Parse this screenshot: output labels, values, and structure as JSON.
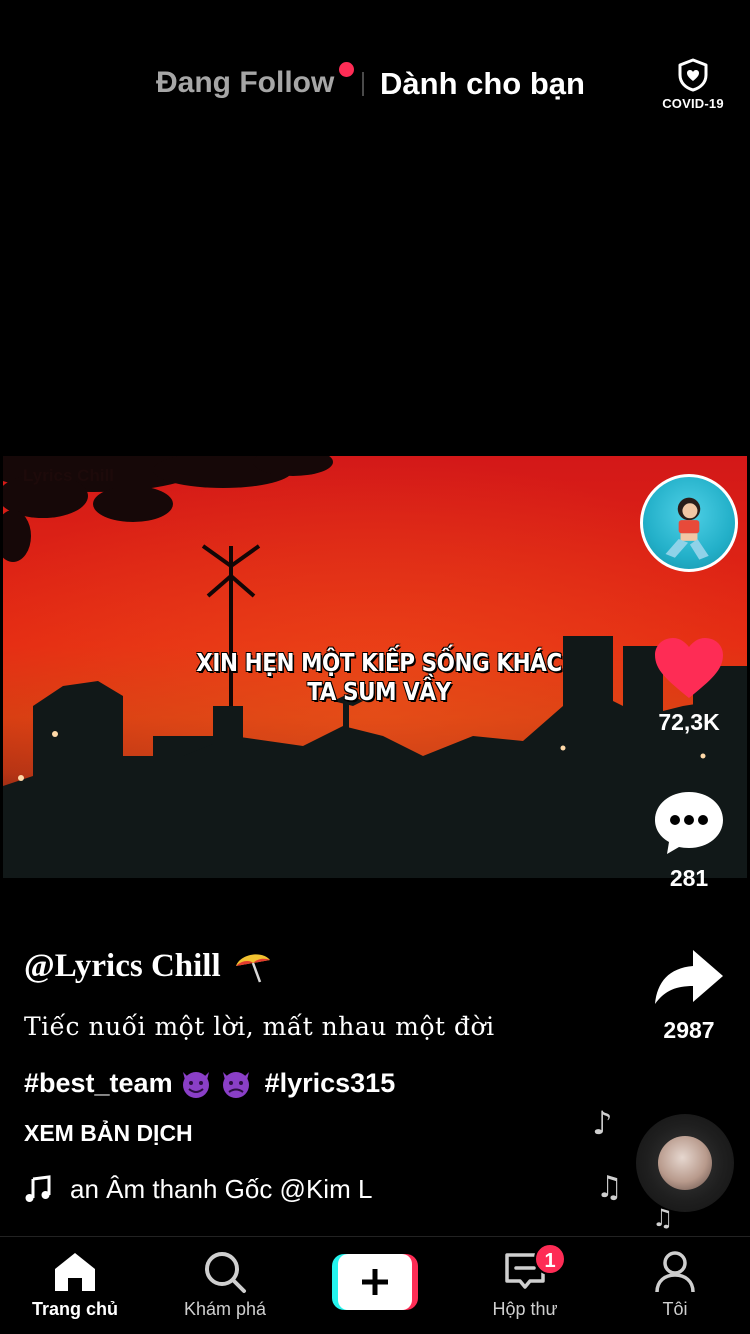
{
  "top_tabs": {
    "following_label": "Đang Follow",
    "for_you_label": "Dành cho bạn",
    "covid_label": "COVID-19",
    "new_dot_color": "#fe2c55"
  },
  "video": {
    "watermark": "Lyrics Chill",
    "lyric_overlay": "XIN HẸN MỘT KIẾP SỐNG KHÁC TA SUM VẦY"
  },
  "right_rail": {
    "like_count": "72,3K",
    "comment_count": "281",
    "share_count": "2987",
    "like_color": "#fe2c55",
    "icons": [
      "creator-avatar",
      "heart-icon",
      "comment-icon",
      "share-icon",
      "music-disc"
    ]
  },
  "caption": {
    "username": "@Lyrics Chill",
    "description": "Tiếc nuối một lời, mất nhau một đời",
    "hashtag_1": "#best_team",
    "hashtag_2": "#lyrics315",
    "translate_label": "XEM BẢN DỊCH",
    "music_text": "an Âm thanh Gốc    @Kim L"
  },
  "bottom_nav": {
    "home_label": "Trang chủ",
    "discover_label": "Khám phá",
    "inbox_label": "Hộp thư",
    "inbox_badge": "1",
    "profile_label": "Tôi",
    "create_colors": {
      "cyan": "#25f4ee",
      "pink": "#fe2c55"
    }
  }
}
